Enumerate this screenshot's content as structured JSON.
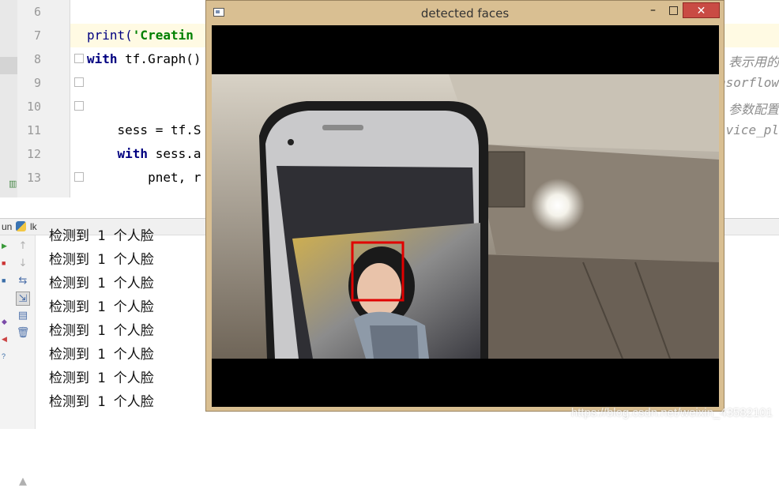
{
  "editor": {
    "lines": [
      {
        "number": "6",
        "code": ""
      },
      {
        "number": "7",
        "code_kw": "print(",
        "code_str": "'Creatin"
      },
      {
        "number": "8",
        "code_kw": "with",
        "code_rest": " tf.Graph()"
      },
      {
        "number": "9",
        "code": ""
      },
      {
        "number": "10",
        "code": ""
      },
      {
        "number": "11",
        "code": "    sess = tf.S"
      },
      {
        "number": "12",
        "code_kw": "    with",
        "code_rest": " sess.a"
      },
      {
        "number": "13",
        "code": "        pnet, r"
      }
    ],
    "right_fragments": [
      "表示用的",
      "nsorflow",
      "参数配置",
      "vice_pl"
    ]
  },
  "run_panel": {
    "label": "un",
    "tab": "lk",
    "output_lines": [
      "检测到 1 个人脸",
      "检测到 1 个人脸",
      "检测到 1 个人脸",
      "检测到 1 个人脸",
      "检测到 1 个人脸",
      "检测到 1 个人脸",
      "检测到 1 个人脸",
      "检测到 1 个人脸"
    ],
    "tools": [
      "up-arrow-icon",
      "down-arrow-icon",
      "soft-wrap-icon",
      "scroll-to-end-icon",
      "print-icon",
      "trash-icon"
    ]
  },
  "cv_window": {
    "title": "detected faces",
    "minimize": "–",
    "maximize": "□",
    "close": "✕",
    "face_box_color": "#e00000"
  },
  "watermark": "https://blog.csdn.net/weixin_43582101"
}
